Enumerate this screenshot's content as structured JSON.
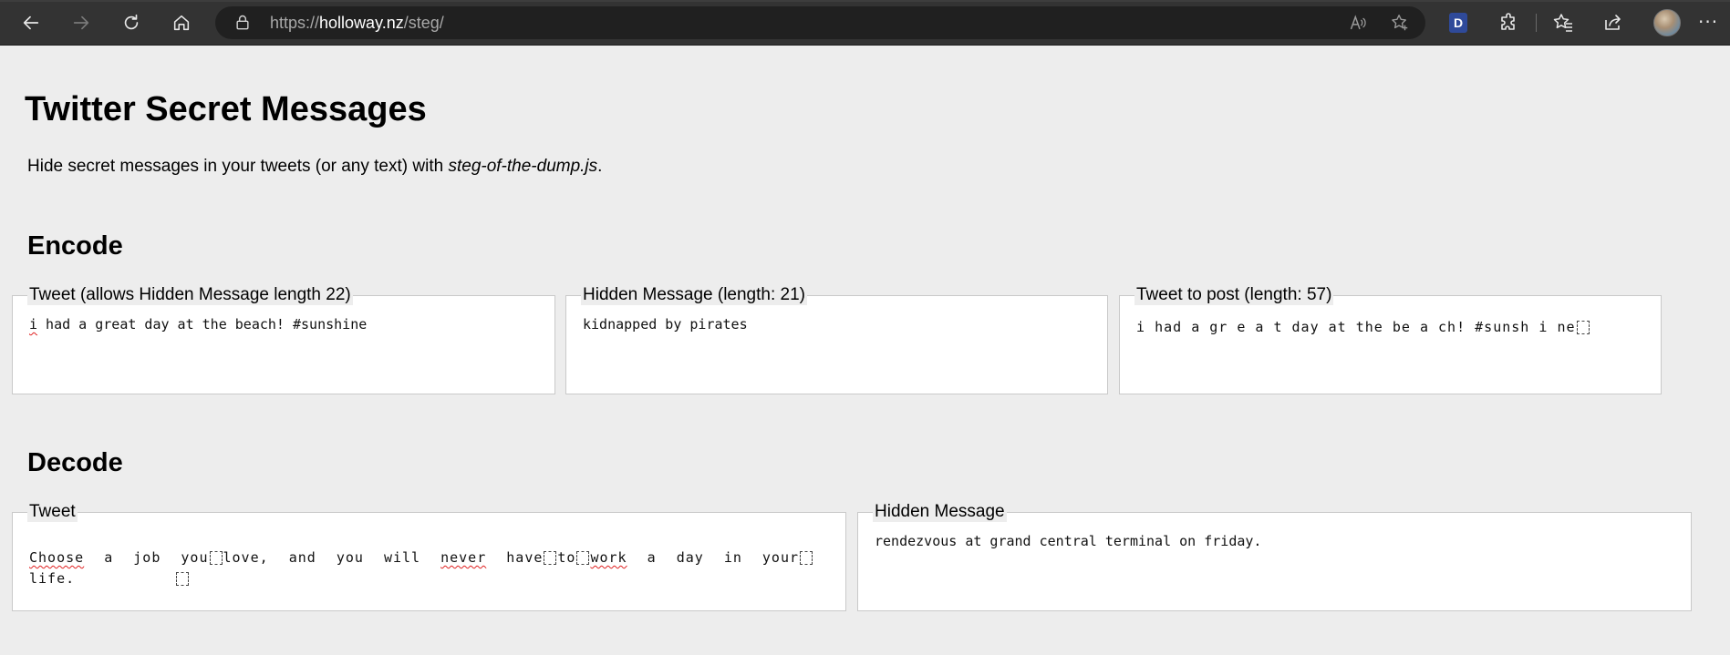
{
  "browser": {
    "url_prefix": "https://",
    "url_host": "holloway.nz",
    "url_path": "/steg/",
    "profile_badge": "D",
    "more_menu": "···",
    "icons": [
      "back-icon",
      "forward-icon",
      "refresh-icon",
      "home-icon",
      "lock-icon",
      "read-aloud-icon",
      "add-favorite-icon",
      "extensions-icon",
      "favorites-icon",
      "share-icon",
      "profile-avatar",
      "more-icon"
    ]
  },
  "page": {
    "title": "Twitter Secret Messages",
    "intro_prefix": "Hide secret messages in your tweets (or any text) with ",
    "intro_link": "steg-of-the-dump.js",
    "intro_suffix": "."
  },
  "encode": {
    "heading": "Encode",
    "tweet_legend": "Tweet (allows Hidden Message length 22)",
    "tweet_first_word": "i",
    "tweet_rest": " had a great day at the beach! #sunshine",
    "hidden_legend": "Hidden Message (length: 21)",
    "hidden_value": "kidnapped by pirates",
    "post_legend": "Tweet to post (length: 57)",
    "post_parts": [
      "i",
      "had",
      "a",
      "gr",
      "e",
      "a",
      "t",
      "day",
      "at",
      "the",
      "be",
      "a",
      "ch!",
      "#sunsh",
      "i",
      "ne"
    ]
  },
  "decode": {
    "heading": "Decode",
    "tweet_legend": "Tweet",
    "tweet_words": [
      "Choose",
      "a",
      "job",
      "you",
      "love,",
      "and",
      "you",
      "will",
      "never",
      "have",
      "to",
      "work",
      "a",
      "day",
      "in",
      "your",
      "life."
    ],
    "hidden_legend": "Hidden Message",
    "hidden_value": "rendezvous at grand central terminal on friday."
  },
  "colors": {
    "page_bg": "#ededed",
    "chrome_bg": "#333333",
    "address_bg": "#202020",
    "spellcheck": "#e02020"
  }
}
